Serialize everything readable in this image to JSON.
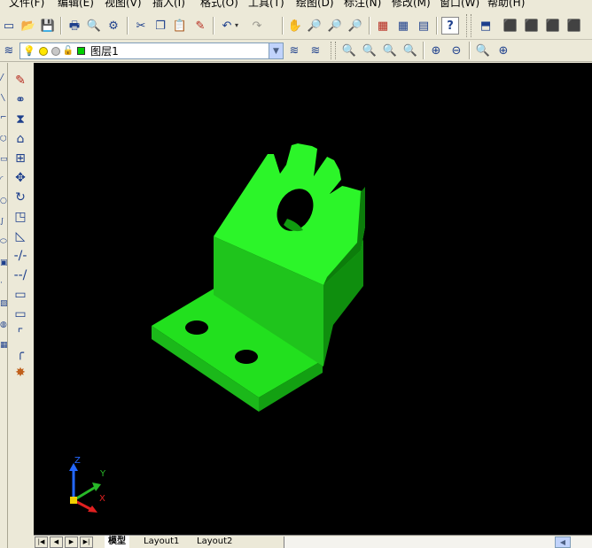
{
  "menu": [
    "文件(F)",
    "编辑(E)",
    "视图(V)",
    "插入(I)",
    "格式(O)",
    "工具(T)",
    "绘图(D)",
    "标注(N)",
    "修改(M)",
    "窗口(W)",
    "帮助(H)"
  ],
  "layer": {
    "name": "图层1",
    "color": "#00d000"
  },
  "ucs": {
    "x": "X",
    "y": "Y",
    "z": "Z"
  },
  "tabs": {
    "model": "模型",
    "layout1": "Layout1",
    "layout2": "Layout2"
  },
  "colors": {
    "part": "#22e01e",
    "canvas_bg": "#000000",
    "ui_bg": "#ece9d8"
  },
  "icons": {
    "row1": [
      "new-icon",
      "open-icon",
      "save-icon",
      "print-icon",
      "print-preview-icon",
      "publish-icon",
      "cut-icon",
      "copy-icon",
      "paste-icon",
      "match-properties-icon",
      "undo-icon",
      "redo-icon",
      "pan-icon",
      "zoom-realtime-icon",
      "zoom-window-icon",
      "zoom-previous-icon",
      "properties-icon",
      "design-center-icon",
      "tool-palettes-icon",
      "help-icon",
      "view-top-icon",
      "view-front-icon",
      "view-side-icon",
      "view-iso-icon",
      "view-iso2-icon"
    ],
    "row2": [
      "layer-manager-icon",
      "layer-previous-icon",
      "zoom-in-icon",
      "zoom-out-icon",
      "zoom-all-icon",
      "zoom-extents-icon",
      "zoom-scale-icon",
      "zoom-center-icon",
      "zoom-object-icon",
      "zoom-dynamic-icon"
    ],
    "side": [
      "erase-icon",
      "copy-object-icon",
      "mirror-icon",
      "offset-icon",
      "array-icon",
      "move-icon",
      "rotate-icon",
      "scale-icon",
      "stretch-icon",
      "trim-icon",
      "extend-icon",
      "break-icon",
      "join-icon",
      "chamfer-icon",
      "fillet-icon",
      "explode-icon"
    ]
  }
}
